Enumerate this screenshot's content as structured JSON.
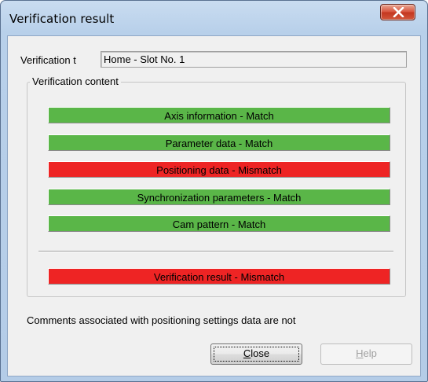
{
  "window": {
    "title": "Verification result"
  },
  "verification_target": {
    "label": "Verification t",
    "value": "Home - Slot No. 1"
  },
  "content_group": {
    "legend": "Verification content",
    "items": [
      {
        "text": "Axis information - Match",
        "status": "match"
      },
      {
        "text": "Parameter data - Match",
        "status": "match"
      },
      {
        "text": "Positioning data - Mismatch",
        "status": "mismatch"
      },
      {
        "text": "Synchronization parameters - Match",
        "status": "match"
      },
      {
        "text": "Cam pattern - Match",
        "status": "match"
      }
    ],
    "overall": {
      "text": "Verification result - Mismatch",
      "status": "mismatch"
    }
  },
  "comment": "Comments associated with positioning settings data are not",
  "buttons": {
    "close_first": "C",
    "close_rest": "lose",
    "help_first": "H",
    "help_rest": "elp"
  },
  "colors": {
    "match": "#5ab648",
    "mismatch": "#ee2424"
  },
  "icons": {
    "close": "close-x-icon"
  }
}
